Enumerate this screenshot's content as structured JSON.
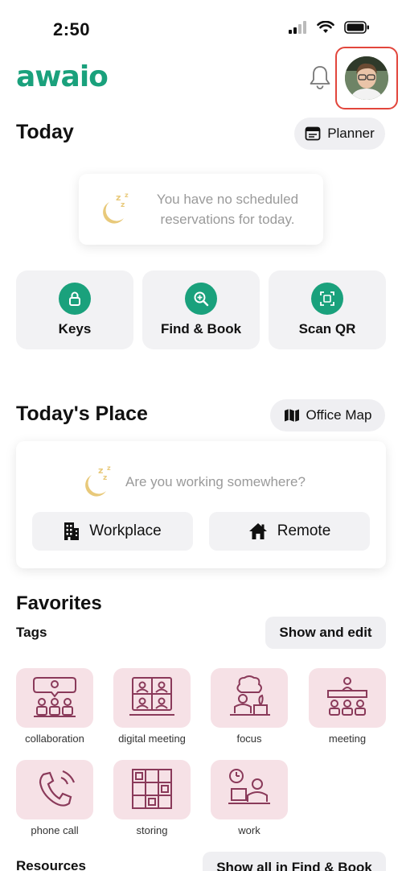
{
  "status_bar": {
    "time": "2:50"
  },
  "header": {
    "logo_text": "awaio"
  },
  "today": {
    "title": "Today",
    "planner_label": "Planner",
    "empty_message": "You have no scheduled reservations for today."
  },
  "quick_actions": [
    {
      "label": "Keys",
      "icon": "lock-icon"
    },
    {
      "label": "Find & Book",
      "icon": "zoom-in-icon"
    },
    {
      "label": "Scan QR",
      "icon": "qr-scan-icon"
    }
  ],
  "todays_place": {
    "title": "Today's Place",
    "map_label": "Office Map",
    "question": "Are you working somewhere?",
    "workplace_label": "Workplace",
    "remote_label": "Remote"
  },
  "favorites": {
    "title": "Favorites",
    "tags_label": "Tags",
    "show_edit_label": "Show and edit",
    "tags": [
      {
        "label": "collaboration",
        "icon": "collaboration-icon"
      },
      {
        "label": "digital meeting",
        "icon": "digital-meeting-icon"
      },
      {
        "label": "focus",
        "icon": "focus-icon"
      },
      {
        "label": "meeting",
        "icon": "meeting-icon"
      },
      {
        "label": "phone call",
        "icon": "phone-call-icon"
      },
      {
        "label": "storing",
        "icon": "storing-icon"
      },
      {
        "label": "work",
        "icon": "work-icon"
      }
    ],
    "resources_label": "Resources",
    "show_all_label": "Show all in Find & Book"
  },
  "colors": {
    "brand": "#1aa17c",
    "tag_bg": "#f6e1e6",
    "tag_icon": "#8a3a5a",
    "sleep_moon": "#e8c97a"
  }
}
